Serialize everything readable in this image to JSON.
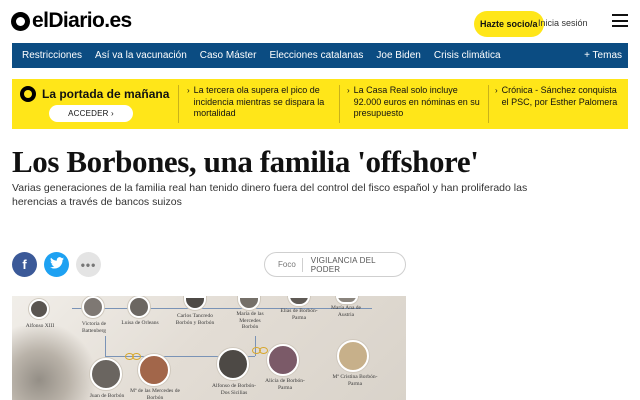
{
  "header": {
    "logo_text": "elDiario.es",
    "subscribe_label": "Hazte socio/a",
    "login_label": "Inicia sesión"
  },
  "nav": {
    "items": [
      "Restricciones",
      "Así va la vacunación",
      "Caso Máster",
      "Elecciones catalanas",
      "Joe Biden",
      "Crisis climática"
    ],
    "more_label": "+ Temas"
  },
  "promo": {
    "title": "La portada de mañana",
    "button_label": "ACCEDER ›",
    "items": [
      "La tercera ola supera el pico de incidencia mientras se dispara la mortalidad",
      "La Casa Real solo incluye 92.000 euros en nóminas en su presupuesto",
      "Crónica - Sánchez conquista el PSC, por Esther Palomera"
    ]
  },
  "article": {
    "headline": "Los Borbones, una familia 'offshore'",
    "standfirst": "Varias generaciones de la familia real han tenido dinero fuera del control del fisco español y han proliferado las herencias a través de bancos suizos",
    "tag_prefix": "Foco",
    "tag_topic": "VIGILANCIA DEL PODER"
  },
  "share": {
    "facebook_glyph": "f",
    "twitter_glyph": "t",
    "more_glyph": "•••"
  },
  "family_tree": {
    "people": [
      "Alfonso XIII",
      "Victoria de Battenberg",
      "Luisa de Orleans",
      "Carlos Tancredo Borbón y Borbón",
      "María de las Mercedes Borbón",
      "Elías de Borbón-Parma",
      "María Ana de Austria",
      "Juan de Borbón",
      "Mª de las Mercedes de Borbón",
      "Alfonso de Borbón-Dos Sicilias",
      "Alicia de Borbón-Parma",
      "Mª Cristina Borbón-Parma"
    ]
  },
  "colors": {
    "nav_bg": "#0b4c82",
    "promo_bg": "#ffe619",
    "facebook": "#3b5998",
    "twitter": "#1da1f2"
  }
}
